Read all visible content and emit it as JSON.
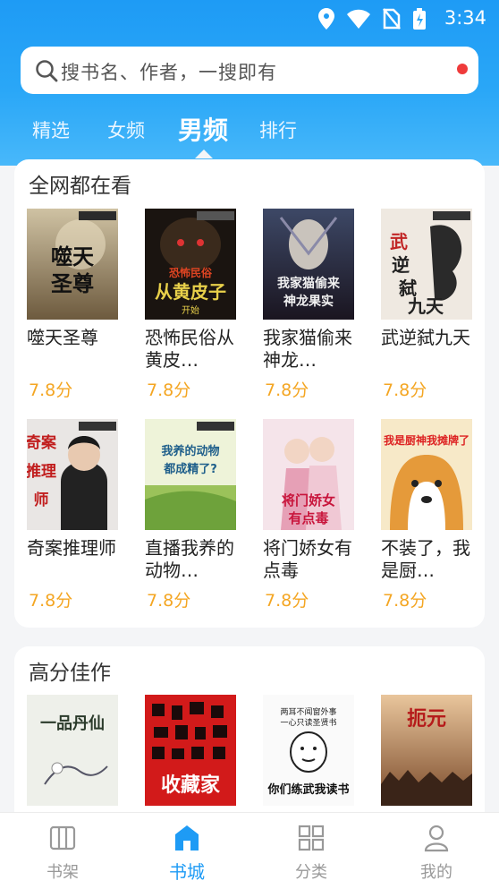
{
  "status_bar": {
    "time": "3:34"
  },
  "search": {
    "placeholder": "搜书名、作者，一搜即有"
  },
  "tabs": [
    {
      "label": "精选",
      "active": false
    },
    {
      "label": "女频",
      "active": false
    },
    {
      "label": "男频",
      "active": true
    },
    {
      "label": "排行",
      "active": false
    }
  ],
  "sections": [
    {
      "title": "全网都在看",
      "books": [
        {
          "title": "噬天圣尊",
          "rating": "7.8分",
          "cover_text": "噬天圣尊"
        },
        {
          "title": "恐怖民俗从黄皮…",
          "rating": "7.8分",
          "cover_text": "恐怖民俗 从黄皮子开始"
        },
        {
          "title": "我家猫偷来神龙…",
          "rating": "7.8分",
          "cover_text": "我家猫偷来神龙果实"
        },
        {
          "title": "武逆弑九天",
          "rating": "7.8分",
          "cover_text": "武逆弑九天"
        },
        {
          "title": "奇案推理师",
          "rating": "7.8分",
          "cover_text": "奇案推理师"
        },
        {
          "title": "直播我养的动物…",
          "rating": "7.8分",
          "cover_text": "直播：我养的动物都成精了？"
        },
        {
          "title": "将门娇女有点毒",
          "rating": "7.8分",
          "cover_text": "将门娇女有点毒"
        },
        {
          "title": "不装了，我是厨…",
          "rating": "7.8分",
          "cover_text": "我是厨神我摊牌了"
        }
      ]
    },
    {
      "title": "高分佳作",
      "books": [
        {
          "title": "",
          "rating": "",
          "cover_text": "一品丹仙"
        },
        {
          "title": "",
          "rating": "",
          "cover_text": "异常收藏家"
        },
        {
          "title": "",
          "rating": "",
          "cover_text": "你们练武我读书"
        },
        {
          "title": "",
          "rating": "",
          "cover_text": "扼元"
        }
      ]
    }
  ],
  "bottom_nav": [
    {
      "label": "书架",
      "icon": "bookshelf-icon",
      "active": false
    },
    {
      "label": "书城",
      "icon": "home-icon",
      "active": true
    },
    {
      "label": "分类",
      "icon": "category-icon",
      "active": false
    },
    {
      "label": "我的",
      "icon": "profile-icon",
      "active": false
    }
  ],
  "colors": {
    "accent": "#1e9bf5",
    "rating": "#f4a623",
    "search_dot": "#ef3b3b"
  }
}
